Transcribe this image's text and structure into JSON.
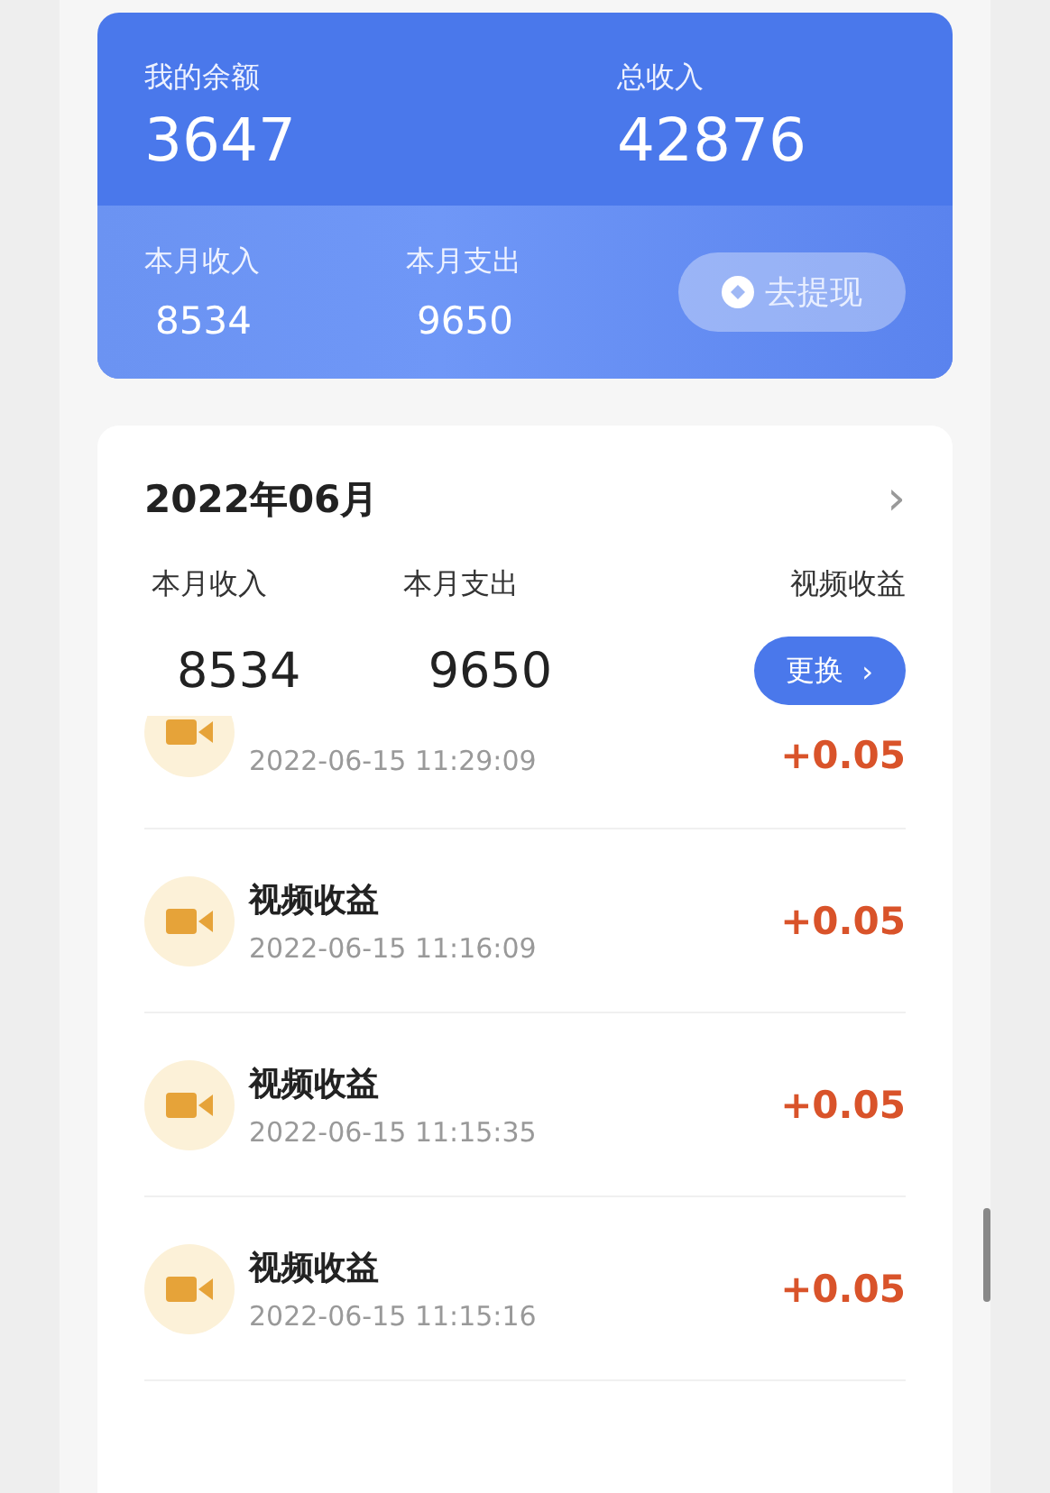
{
  "balance_card": {
    "balance_label": "我的余额",
    "balance": "3647",
    "total_label": "总收入",
    "total": "42876",
    "month_stats": [
      {
        "label": "本月收入",
        "value": "8534"
      },
      {
        "label": "本月支出",
        "value": "9650"
      }
    ],
    "withdraw_button": "去提现"
  },
  "month_card": {
    "title": "2022年06月",
    "chevron": "›",
    "stats": [
      {
        "label": "本月收入",
        "value": "8534"
      },
      {
        "label": "本月支出",
        "value": "9650"
      }
    ],
    "filter_label": "视频收益",
    "filter_button": "更换",
    "filter_arrow": "›"
  },
  "transactions": [
    {
      "time": "2022-06-15 11:29:09",
      "amount": "+0.05"
    },
    {
      "title": "视频收益",
      "time": "2022-06-15 11:16:09",
      "amount": "+0.05"
    },
    {
      "title": "视频收益",
      "time": "2022-06-15 11:15:35",
      "amount": "+0.05"
    },
    {
      "title": "视频收益",
      "time": "2022-06-15 11:15:16",
      "amount": "+0.05"
    }
  ]
}
